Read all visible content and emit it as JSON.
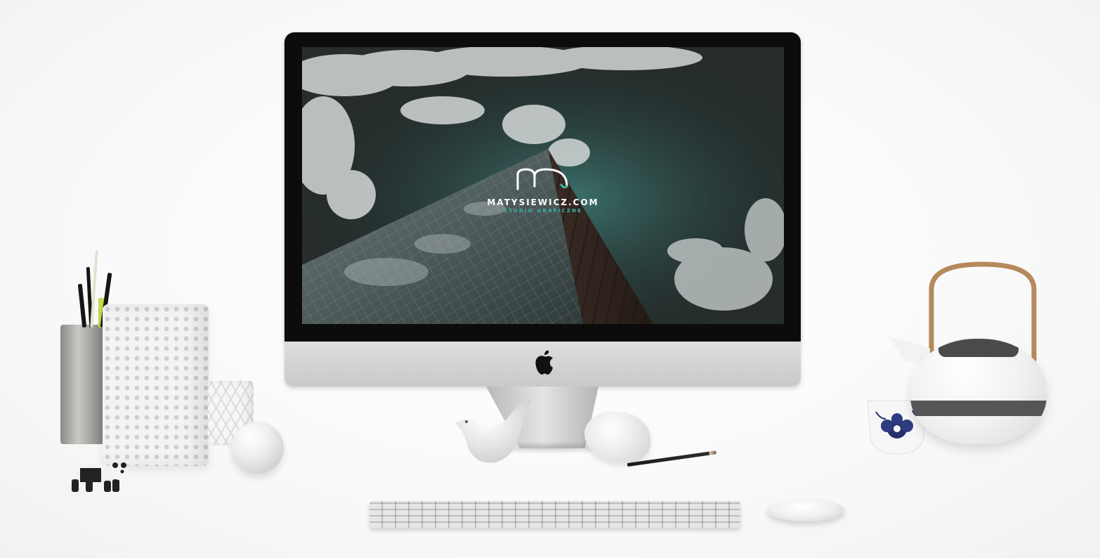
{
  "screen": {
    "brand_name": "MATYSIEWICZ.COM",
    "brand_tagline": "STUDIO GRAFICZNE"
  },
  "colors": {
    "accent": "#39b7a6",
    "bezel": "#0c0c0c",
    "chin": "#d3d3d3"
  },
  "icons": {
    "apple_logo": "apple-icon",
    "brand_mark": "m-monogram-icon"
  }
}
